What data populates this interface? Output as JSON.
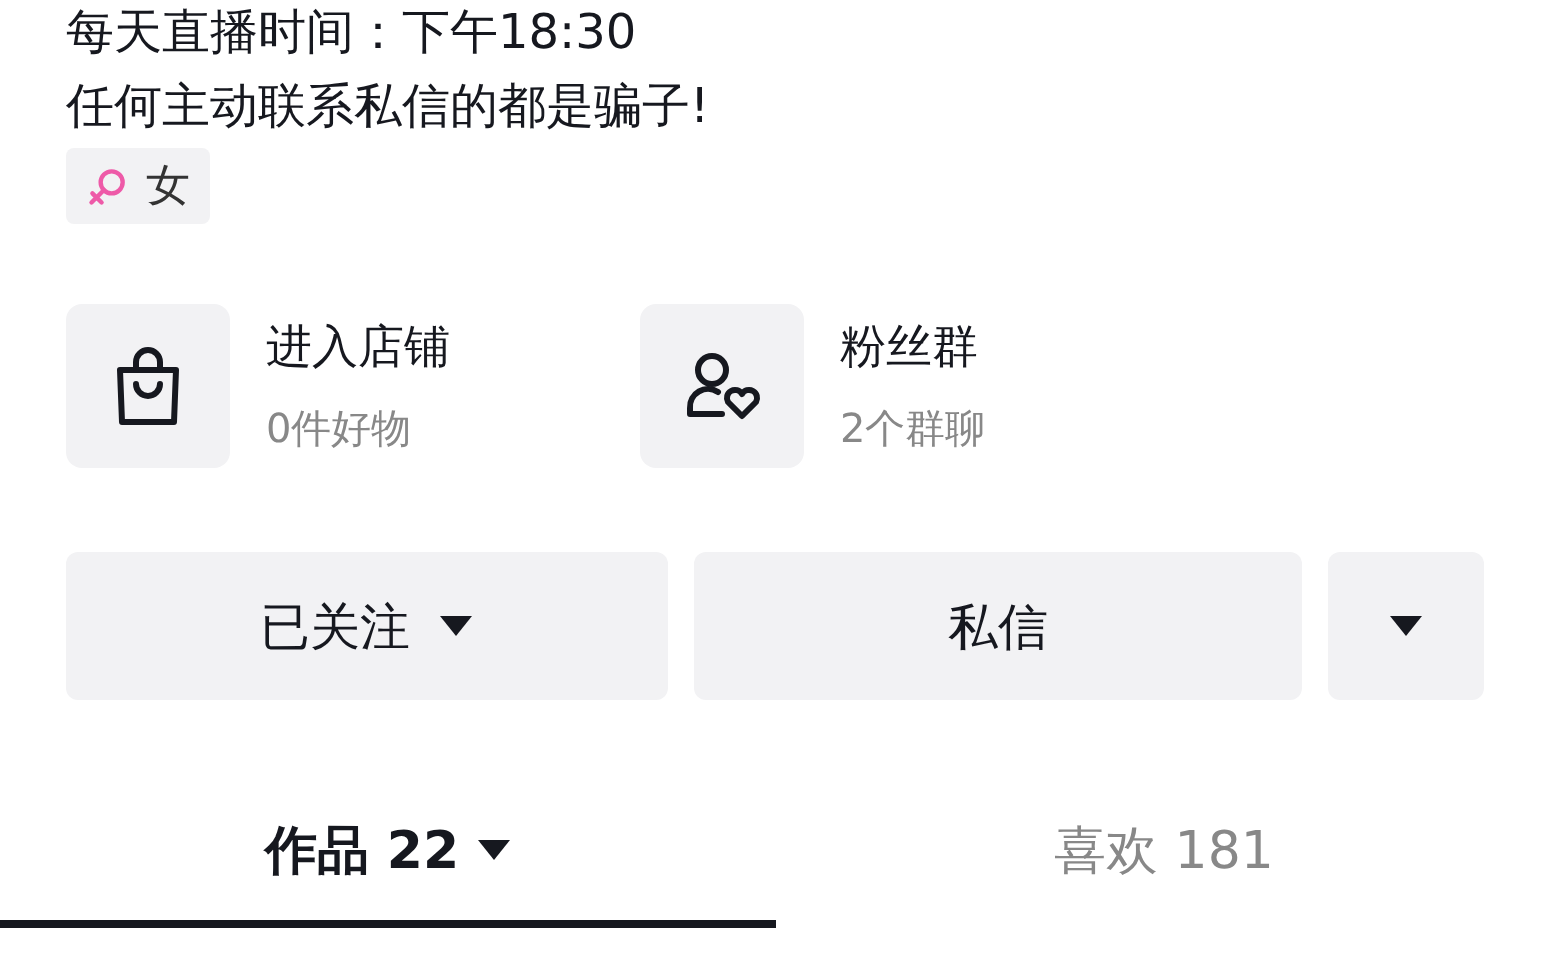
{
  "bio": [
    "每天直播时间：下午18:30",
    "任何主动联系私信的都是骗子!"
  ],
  "tag": {
    "kind": "female",
    "label": "女"
  },
  "entries": [
    {
      "kind": "shop",
      "title": "进入店铺",
      "subtitle": "0件好物"
    },
    {
      "kind": "fans",
      "title": "粉丝群",
      "subtitle": "2个群聊"
    }
  ],
  "buttons": [
    {
      "kind": "dropdown",
      "label": "已关注"
    },
    {
      "kind": "plain",
      "label": "私信"
    },
    {
      "kind": "caret"
    }
  ],
  "tabs": [
    {
      "label": "作品 22",
      "dropdown": true,
      "selected": true
    },
    {
      "label": "喜欢 181",
      "dropdown": false,
      "selected": false
    }
  ]
}
